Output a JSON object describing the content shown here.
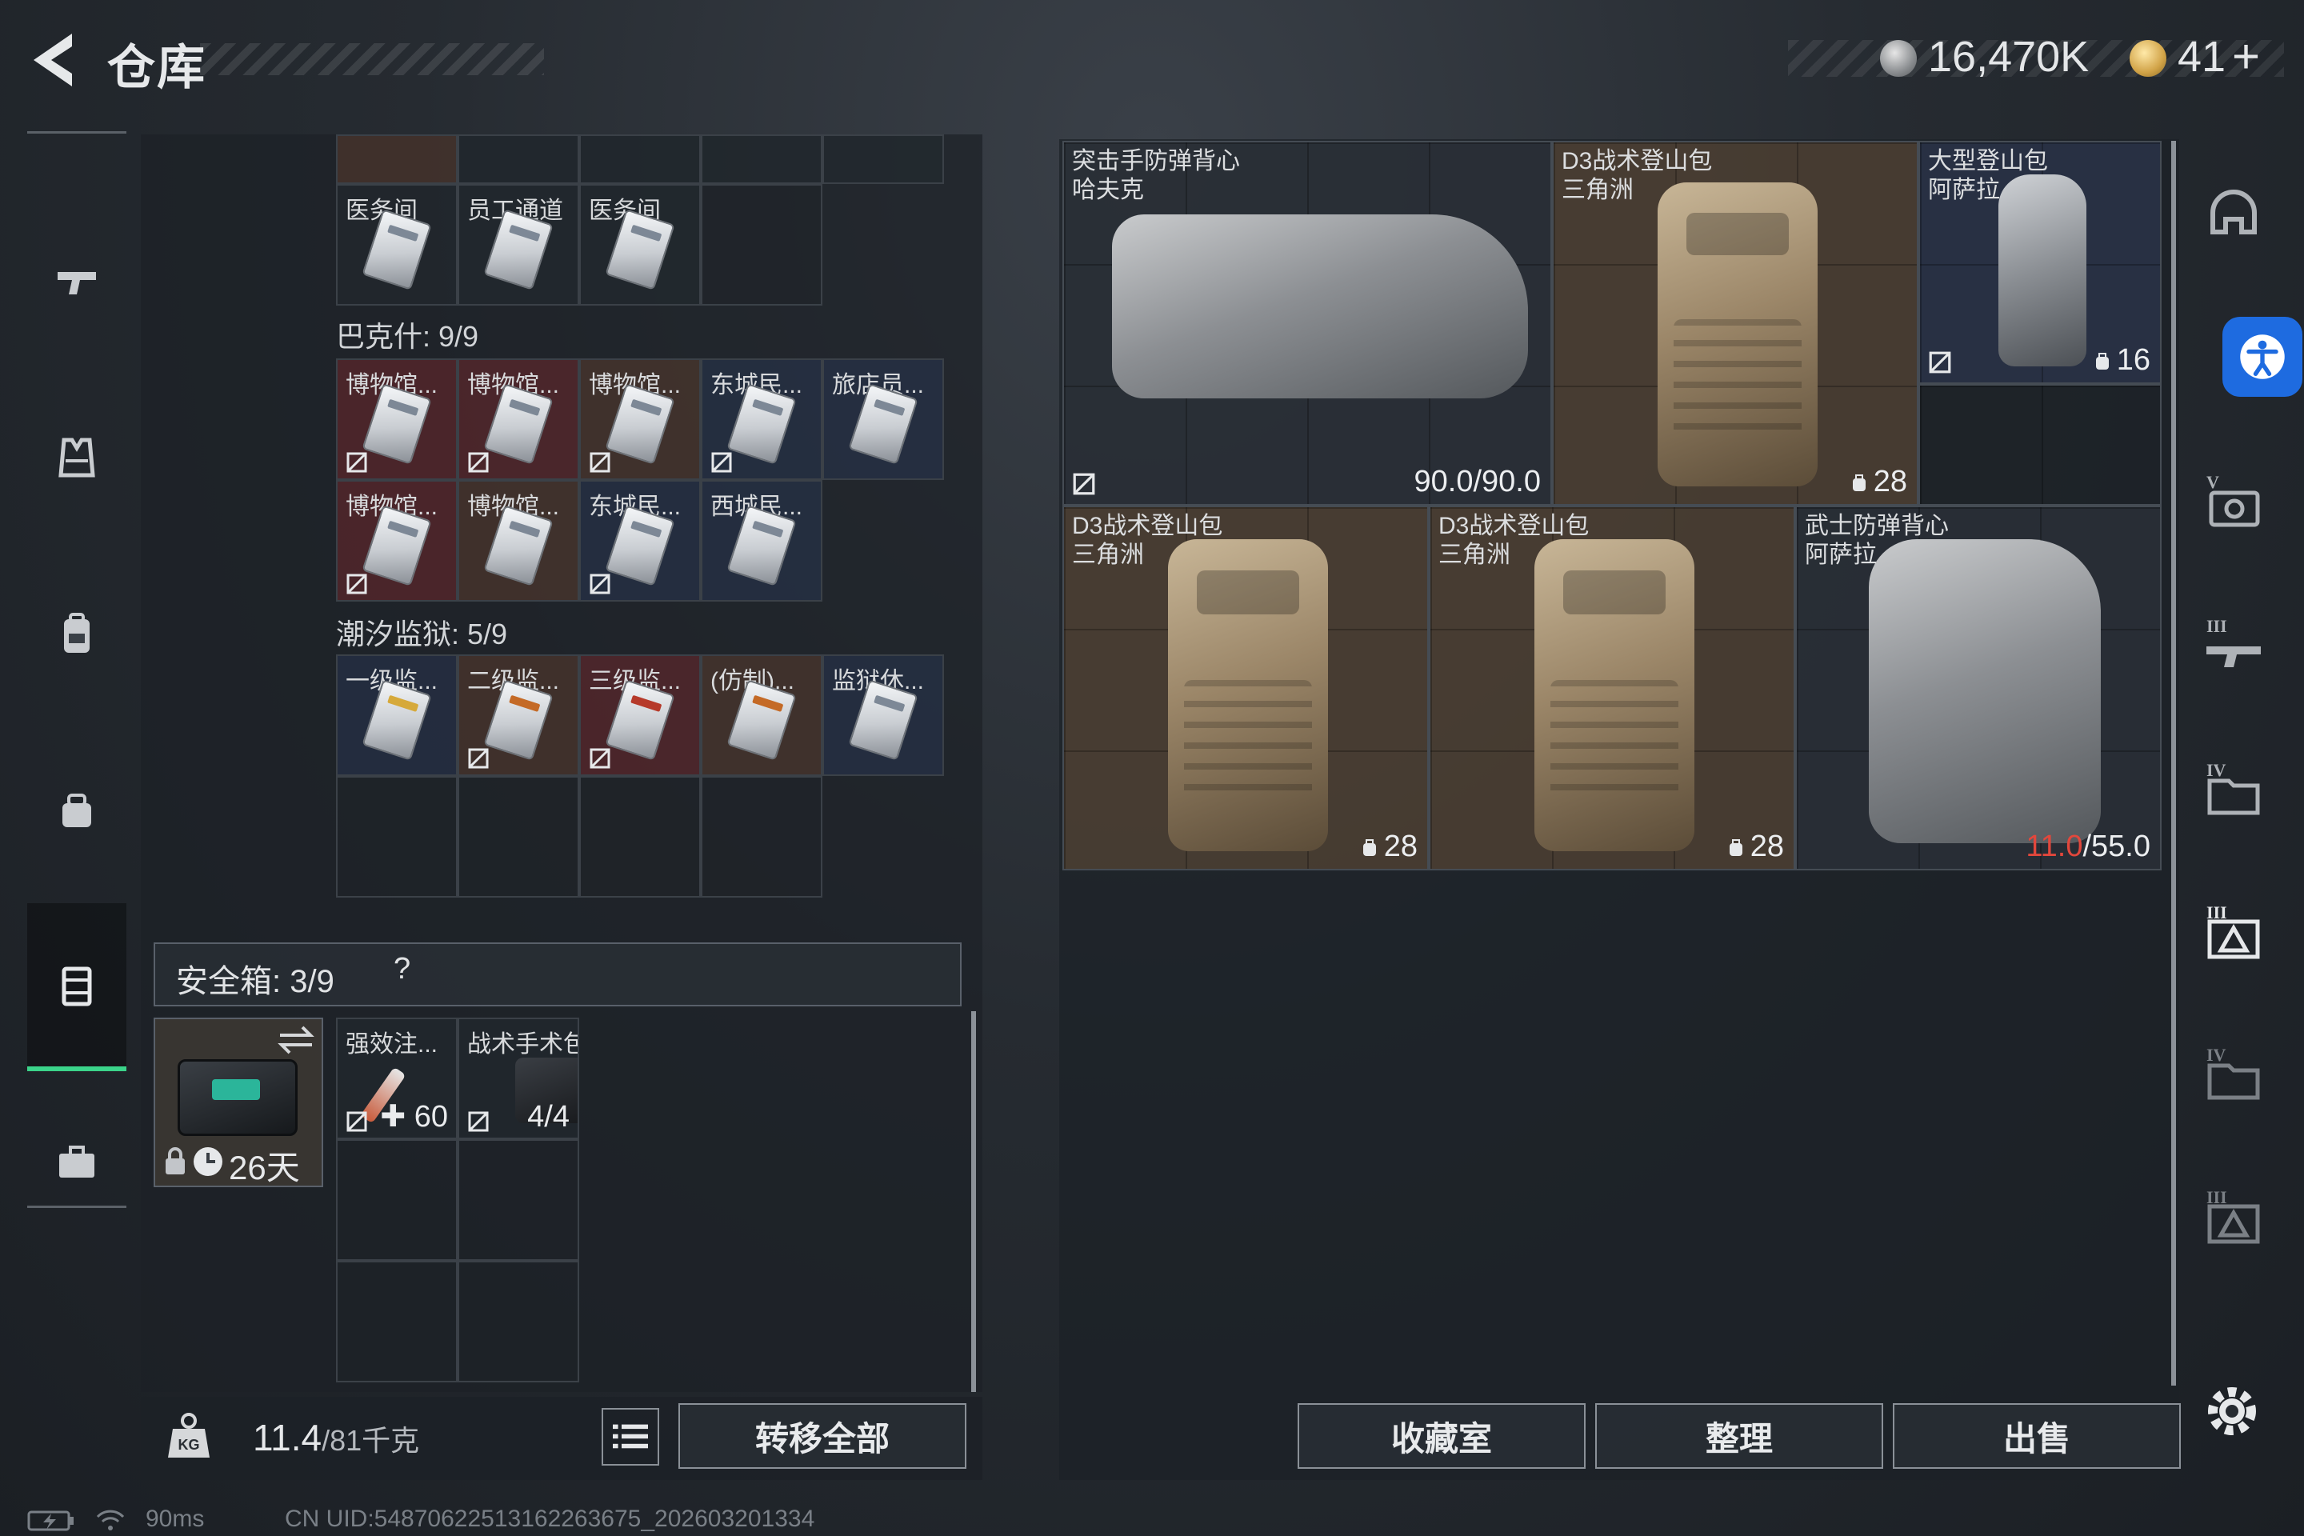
{
  "header": {
    "title": "仓库",
    "coin_value": "16,470K",
    "token_value": "41",
    "token_plus": "+"
  },
  "left_container": {
    "top_row_labels": [
      "医务间",
      "员工通道",
      "医务间"
    ],
    "bakesh": {
      "title": "巴克什: 9/9",
      "row1": [
        "博物馆...",
        "博物馆...",
        "博物馆...",
        "东城民...",
        "旅店员..."
      ],
      "row2": [
        "博物馆...",
        "博物馆...",
        "东城民...",
        "西城民..."
      ]
    },
    "tidal_prison": {
      "title": "潮汐监狱: 5/9",
      "row1": [
        "一级监...",
        "二级监...",
        "三级监...",
        "(仿制)...",
        "监狱休..."
      ]
    },
    "safebox": {
      "title": "安全箱: 3/9",
      "help": "?",
      "days": "26天",
      "items": [
        {
          "name": "强效注...",
          "qty": "60"
        },
        {
          "name": "战术手术包",
          "qty": "4/4"
        }
      ]
    },
    "weight": {
      "current": "11.4",
      "capacity": "/81千克"
    },
    "transfer_all": "转移全部"
  },
  "stash": {
    "items": [
      {
        "name": "突击手防弹背心",
        "sub": "哈夫克",
        "value": "90.0/90.0"
      },
      {
        "name": "D3战术登山包",
        "sub": "三角洲",
        "value": "28"
      },
      {
        "name": "大型登山包",
        "sub": "阿萨拉",
        "value": "16"
      },
      {
        "name": "D3战术登山包",
        "sub": "三角洲",
        "value": "28"
      },
      {
        "name": "D3战术登山包",
        "sub": "三角洲",
        "value": "28"
      },
      {
        "name": "武士防弹背心",
        "sub": "阿萨拉",
        "value_damaged": "11.0",
        "value_max": "/55.0"
      }
    ],
    "buttons": {
      "collection": "收藏室",
      "organize": "整理",
      "sell": "出售"
    }
  },
  "status_bar": {
    "ping": "90ms",
    "uid": "CN UID:54870622513162263675_202603201334"
  },
  "colors": {
    "accent_green": "#3bd48a",
    "damage_red": "#e2473c",
    "a11y_blue": "#1e6be0"
  }
}
